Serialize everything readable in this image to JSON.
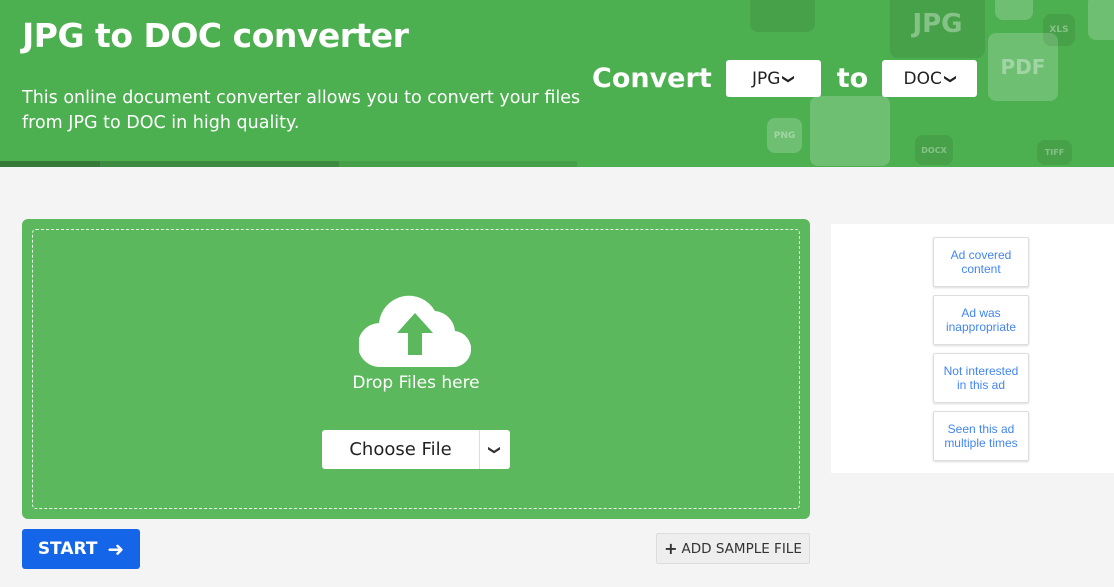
{
  "header": {
    "title": "JPG to DOC converter",
    "description": "This online document converter allows you to convert your files from JPG to DOC in high quality.",
    "convert_label": "Convert",
    "to_label": "to",
    "from_format": "JPG",
    "to_format": "DOC",
    "decor_labels": [
      "JPG",
      "PDF",
      "XLS",
      "PNG",
      "DOCX",
      "TIFF"
    ]
  },
  "upload": {
    "drop_text": "Drop Files here",
    "choose_file": "Choose File"
  },
  "actions": {
    "start": "START",
    "add_sample": "ADD SAMPLE FILE"
  },
  "ad_feedback": [
    "Ad covered content",
    "Ad was inappropriate",
    "Not interested in this ad",
    "Seen this ad multiple times"
  ],
  "colors": {
    "brand_green": "#4caf50",
    "start_blue": "#1565e8",
    "ad_text": "#4285f4"
  }
}
